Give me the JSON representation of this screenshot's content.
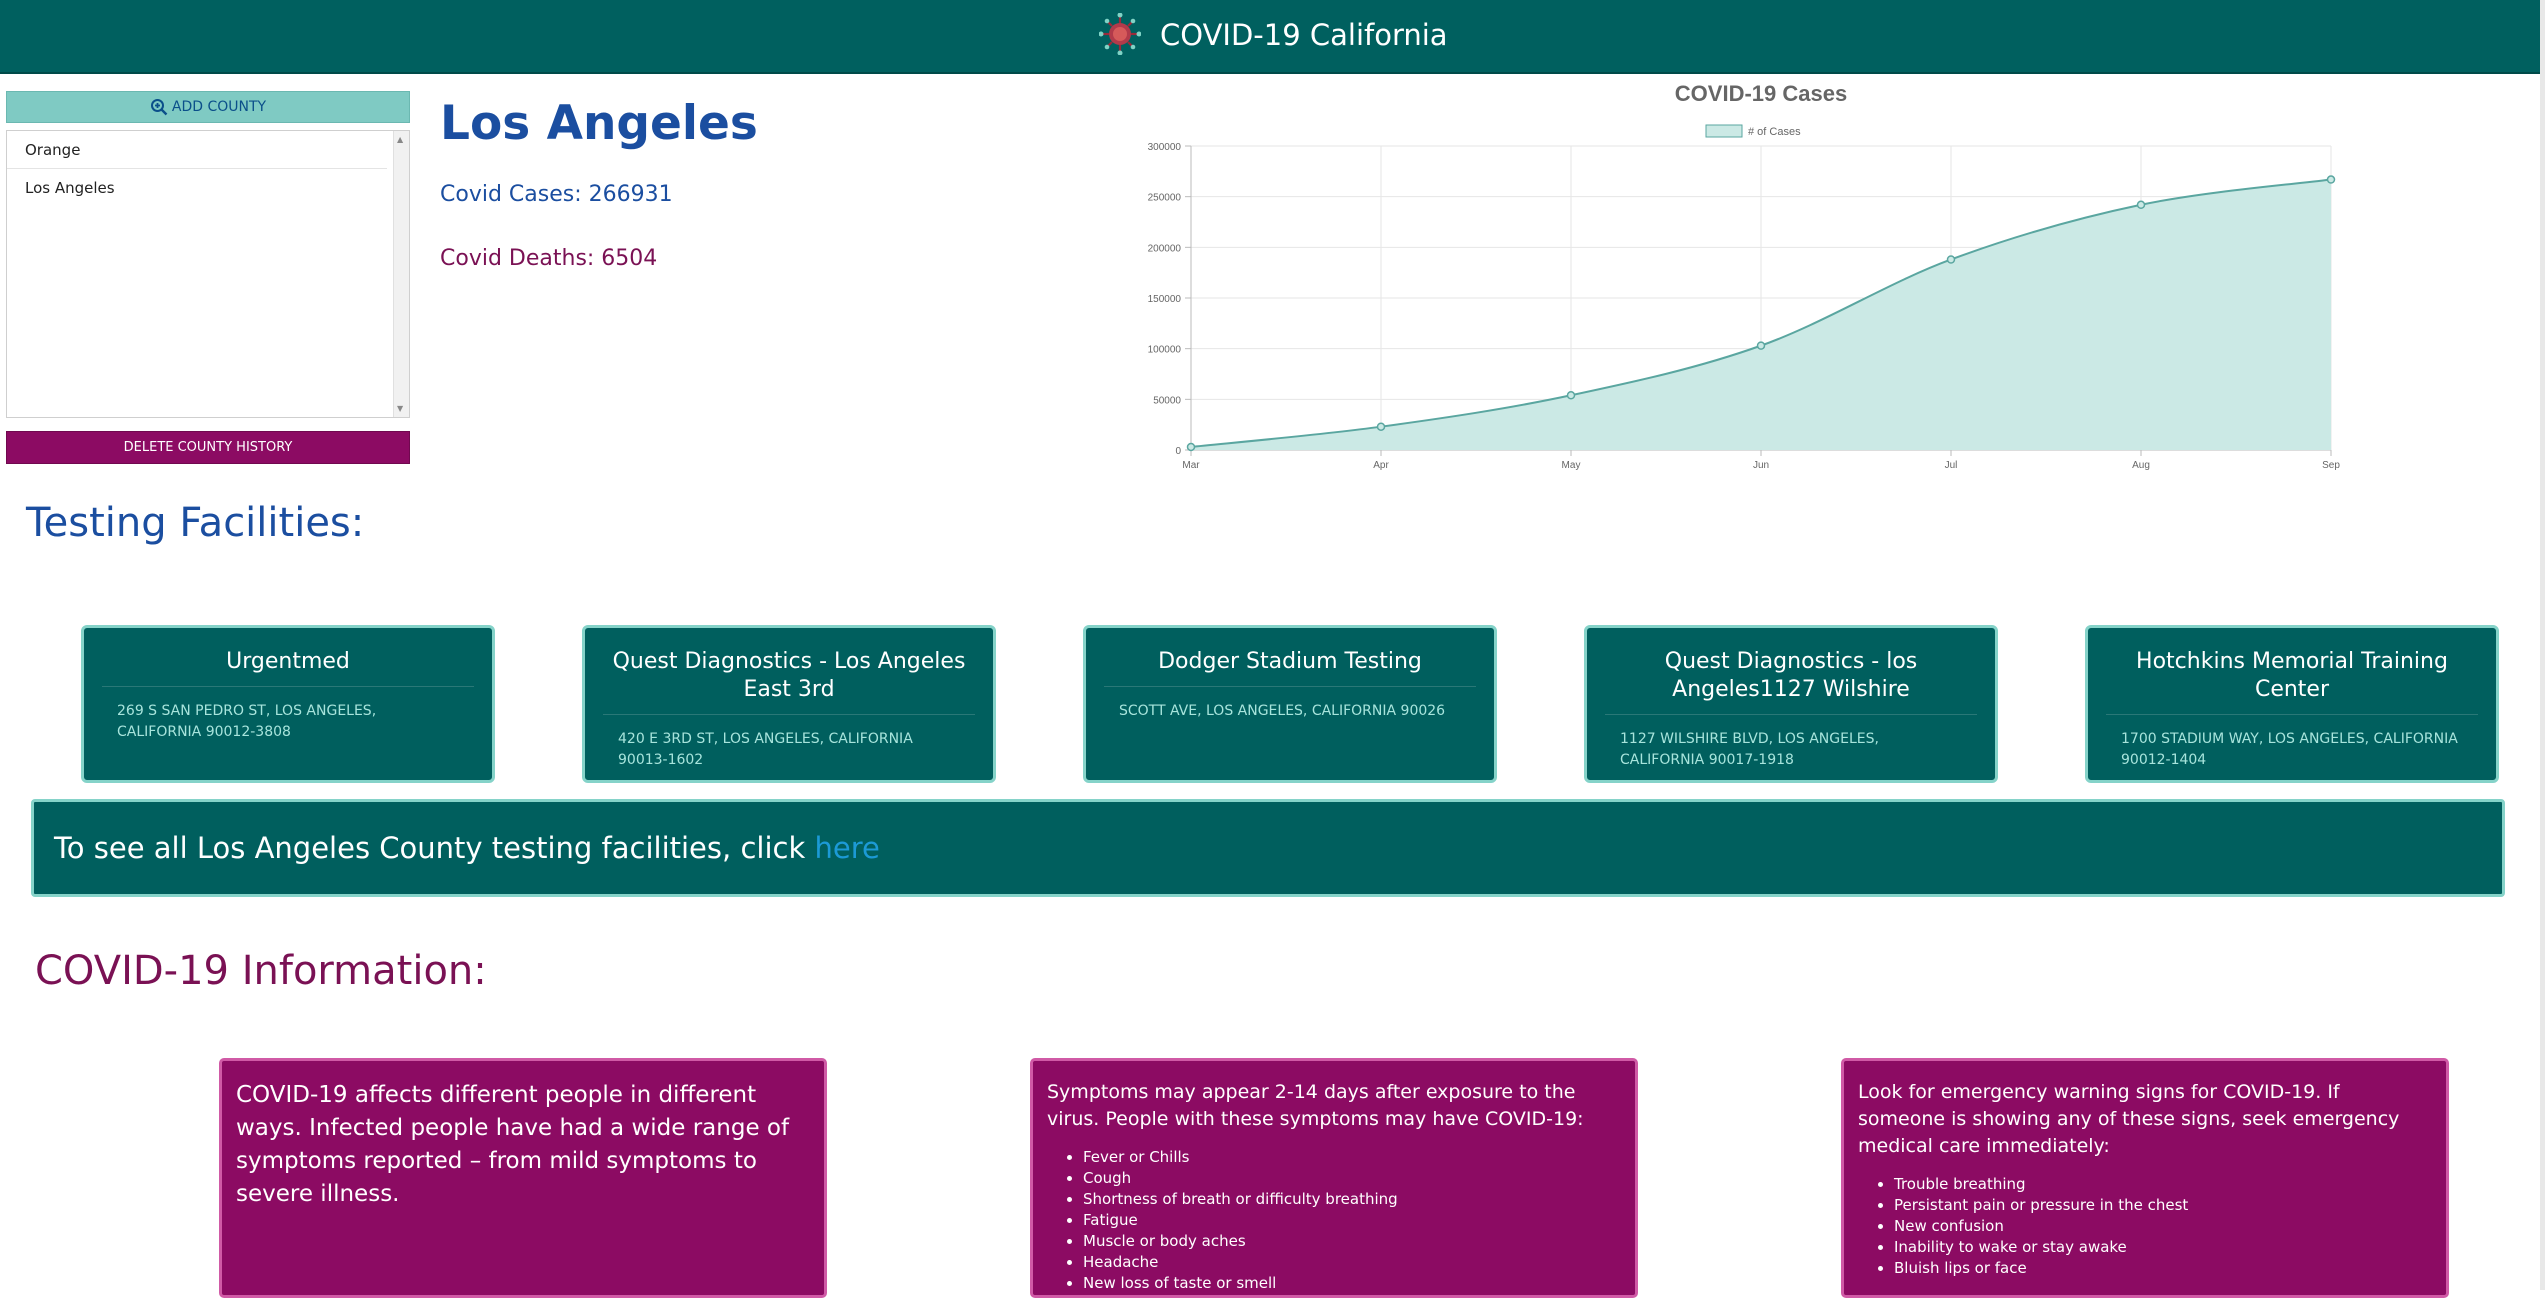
{
  "header": {
    "title": "COVID-19 California",
    "logo_icon": "virus-icon"
  },
  "sidebar": {
    "add_label": "ADD COUNTY",
    "counties": [
      "Orange",
      "Los Angeles"
    ],
    "delete_label": "DELETE COUNTY HISTORY"
  },
  "county": {
    "name": "Los Angeles",
    "cases_text": "Covid Cases: 266931",
    "deaths_text": "Covid Deaths: 6504"
  },
  "chart_data": {
    "type": "area",
    "title": "COVID-19 Cases",
    "series": [
      {
        "name": "# of Cases",
        "values": [
          3000,
          23000,
          54000,
          103000,
          188000,
          242000,
          266931
        ]
      }
    ],
    "categories": [
      "Mar",
      "Apr",
      "May",
      "Jun",
      "Jul",
      "Aug",
      "Sep"
    ],
    "y_ticks": [
      "0",
      "50000",
      "100000",
      "150000",
      "200000",
      "250000",
      "300000"
    ],
    "ylim": [
      0,
      300000
    ],
    "grid": true,
    "legend_position": "top",
    "colors": {
      "line": "#5aa6a0",
      "fill": "#cbe9e5"
    }
  },
  "testing": {
    "title": "Testing Facilities:",
    "facilities": [
      {
        "name": "Urgentmed",
        "address": "269 S SAN PEDRO ST, LOS ANGELES, CALIFORNIA 90012-3808"
      },
      {
        "name": "Quest Diagnostics - Los Angeles East 3rd",
        "address": "420 E 3RD ST, LOS ANGELES, CALIFORNIA 90013-1602"
      },
      {
        "name": "Dodger Stadium Testing",
        "address": "SCOTT AVE, LOS ANGELES, CALIFORNIA 90026"
      },
      {
        "name": "Quest Diagnostics - los Angeles1127 Wilshire",
        "address": "1127 WILSHIRE BLVD, LOS ANGELES, CALIFORNIA 90017-1918"
      },
      {
        "name": "Hotchkins Memorial Training Center",
        "address": "1700 STADIUM WAY, LOS ANGELES, CALIFORNIA 90012-1404"
      }
    ],
    "see_all_text": "To see all Los Angeles County testing facilities, click ",
    "see_all_link": "here"
  },
  "info": {
    "title": "COVID-19 Information:",
    "card1": "COVID-19 affects different people in different ways. Infected people have had a wide range of symptoms reported – from mild symptoms to severe illness.",
    "card2_intro": "Symptoms may appear 2-14 days after exposure to the virus. People with these symptoms may have COVID-19:",
    "card2_items": [
      "Fever or Chills",
      "Cough",
      "Shortness of breath or difficulty breathing",
      "Fatigue",
      "Muscle or body aches",
      "Headache",
      "New loss of taste or smell"
    ],
    "card3_intro": "Look for emergency warning signs for COVID-19. If someone is showing any of these signs, seek emergency medical care immediately:",
    "card3_items": [
      "Trouble breathing",
      "Persistant pain or pressure in the chest",
      "New confusion",
      "Inability to wake or stay awake",
      "Bluish lips or face"
    ]
  }
}
